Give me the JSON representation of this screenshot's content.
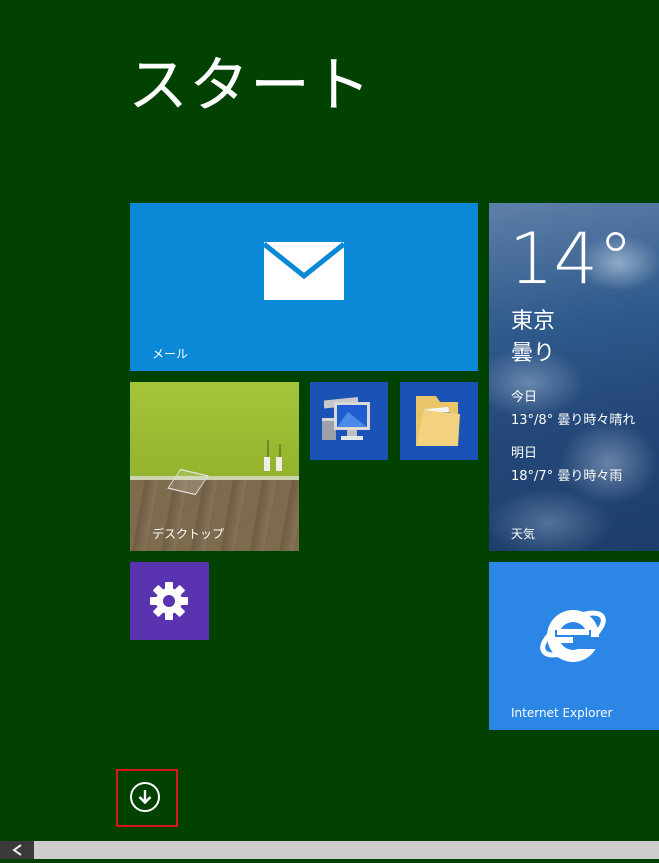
{
  "start": {
    "title": "スタート"
  },
  "tiles": {
    "mail": {
      "label": "メール",
      "icon": "mail-envelope-icon",
      "color": "#0b89d6"
    },
    "weather": {
      "label": "天気",
      "temperature": "14°",
      "city": "東京",
      "condition": "曇り",
      "today_label": "今日",
      "today_forecast": "13°/8° 曇り時々晴れ",
      "tomorrow_label": "明日",
      "tomorrow_forecast": "18°/7° 曇り時々雨"
    },
    "desktop": {
      "label": "デスクトップ"
    },
    "computer": {
      "icon": "computer-icon",
      "color": "#1a52b5"
    },
    "folder": {
      "icon": "folder-icon",
      "color": "#1a52b5"
    },
    "settings": {
      "icon": "gear-icon",
      "color": "#5a33b1"
    },
    "ie": {
      "label": "Internet Explorer",
      "icon": "internet-explorer-icon",
      "color": "#2b86e6"
    }
  },
  "apps_button": {
    "icon": "down-arrow-circle-icon"
  },
  "colors": {
    "background": "#014200",
    "highlight": "#e0141a"
  }
}
